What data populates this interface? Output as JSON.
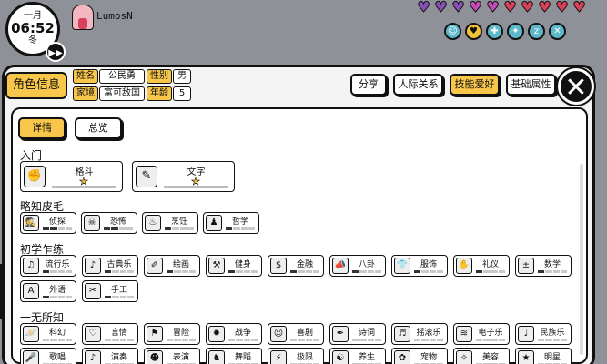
{
  "hud": {
    "month": "一月",
    "time": "06:52",
    "season": "冬",
    "player_name": "LumosN",
    "hearts": [
      "#8a4fb7",
      "#8a4fb7",
      "#8a4fb7",
      "#c34bb4",
      "#c34bb4",
      "#d8405c",
      "#d8405c",
      "#d8405c",
      "#d8405c",
      "#d8405c"
    ],
    "status_icons": [
      "smile-icon",
      "heart-icon",
      "gamepad-icon",
      "sparkle-icon",
      "sleep-icon",
      "tools-icon"
    ]
  },
  "profile": {
    "tab_label": "角色信息",
    "name_label": "姓名",
    "name_value": "公民勇",
    "gender_label": "性别",
    "gender_value": "男",
    "family_label": "家境",
    "family_value": "富可敌国",
    "age_label": "年龄",
    "age_value": "5"
  },
  "top_buttons": {
    "share": "分享",
    "relations": "人际关系",
    "skills": "技能爱好",
    "attributes": "基础属性"
  },
  "close_symbol": "✕",
  "sub_tabs": {
    "detail": "详情",
    "overview": "总览"
  },
  "categories": {
    "intro": "入门",
    "basic": "略知皮毛",
    "beginner": "初学乍练",
    "none": "一无所知"
  },
  "intro_skills": [
    {
      "name": "格斗",
      "icon": "fist-icon",
      "glyph": "✊"
    },
    {
      "name": "文字",
      "icon": "writing-icon",
      "glyph": "✎"
    }
  ],
  "basic_skills": [
    {
      "name": "侦探",
      "icon": "detective-icon",
      "glyph": "🕵",
      "level": 2
    },
    {
      "name": "恐怖",
      "icon": "skull-icon",
      "glyph": "☠",
      "level": 2
    },
    {
      "name": "烹饪",
      "icon": "cooking-icon",
      "glyph": "♨",
      "level": 1
    },
    {
      "name": "哲学",
      "icon": "philosophy-icon",
      "glyph": "♟",
      "level": 1
    }
  ],
  "beginner_skills_row1": [
    {
      "name": "流行乐",
      "icon": "headphones-icon",
      "glyph": "♫",
      "level": 1
    },
    {
      "name": "古典乐",
      "icon": "piano-icon",
      "glyph": "♪",
      "level": 1
    },
    {
      "name": "绘画",
      "icon": "paint-icon",
      "glyph": "✐",
      "level": 1
    },
    {
      "name": "健身",
      "icon": "dumbbell-icon",
      "glyph": "⚒",
      "level": 1
    },
    {
      "name": "金融",
      "icon": "money-icon",
      "glyph": "$",
      "level": 1
    },
    {
      "name": "八卦",
      "icon": "megaphone-icon",
      "glyph": "📣",
      "level": 1
    },
    {
      "name": "服饰",
      "icon": "shirt-icon",
      "glyph": "👕",
      "level": 1
    },
    {
      "name": "礼仪",
      "icon": "handshake-icon",
      "glyph": "✋",
      "level": 1
    },
    {
      "name": "数学",
      "icon": "calculator-icon",
      "glyph": "±",
      "level": 1
    }
  ],
  "beginner_skills_row2": [
    {
      "name": "外语",
      "icon": "language-icon",
      "glyph": "A",
      "level": 1
    },
    {
      "name": "手工",
      "icon": "craft-icon",
      "glyph": "✂",
      "level": 1
    }
  ],
  "none_skills_row1": [
    {
      "name": "科幻",
      "icon": "planet-icon",
      "glyph": "🪐"
    },
    {
      "name": "言情",
      "icon": "romance-icon",
      "glyph": "♡"
    },
    {
      "name": "冒险",
      "icon": "map-icon",
      "glyph": "⚑"
    },
    {
      "name": "战争",
      "icon": "bomb-icon",
      "glyph": "✹"
    },
    {
      "name": "喜剧",
      "icon": "comedy-icon",
      "glyph": "☺"
    },
    {
      "name": "诗词",
      "icon": "scroll-icon",
      "glyph": "✒"
    },
    {
      "name": "摇滚乐",
      "icon": "guitar-icon",
      "glyph": "♬"
    },
    {
      "name": "电子乐",
      "icon": "synth-icon",
      "glyph": "≋"
    },
    {
      "name": "民族乐",
      "icon": "drum-icon",
      "glyph": "♩"
    }
  ],
  "none_skills_row2": [
    {
      "name": "歌唱",
      "icon": "microphone-icon",
      "glyph": "🎤"
    },
    {
      "name": "演奏",
      "icon": "violin-icon",
      "glyph": "♪"
    },
    {
      "name": "表演",
      "icon": "mask-icon",
      "glyph": "☻"
    },
    {
      "name": "舞蹈",
      "icon": "dance-icon",
      "glyph": "♞"
    },
    {
      "name": "极限",
      "icon": "extreme-icon",
      "glyph": "⚡"
    },
    {
      "name": "养生",
      "icon": "yinyang-icon",
      "glyph": "☯"
    },
    {
      "name": "宠物",
      "icon": "paw-icon",
      "glyph": "✿"
    },
    {
      "name": "美容",
      "icon": "beauty-icon",
      "glyph": "✧"
    },
    {
      "name": "明星",
      "icon": "star-icon",
      "glyph": "★"
    }
  ]
}
